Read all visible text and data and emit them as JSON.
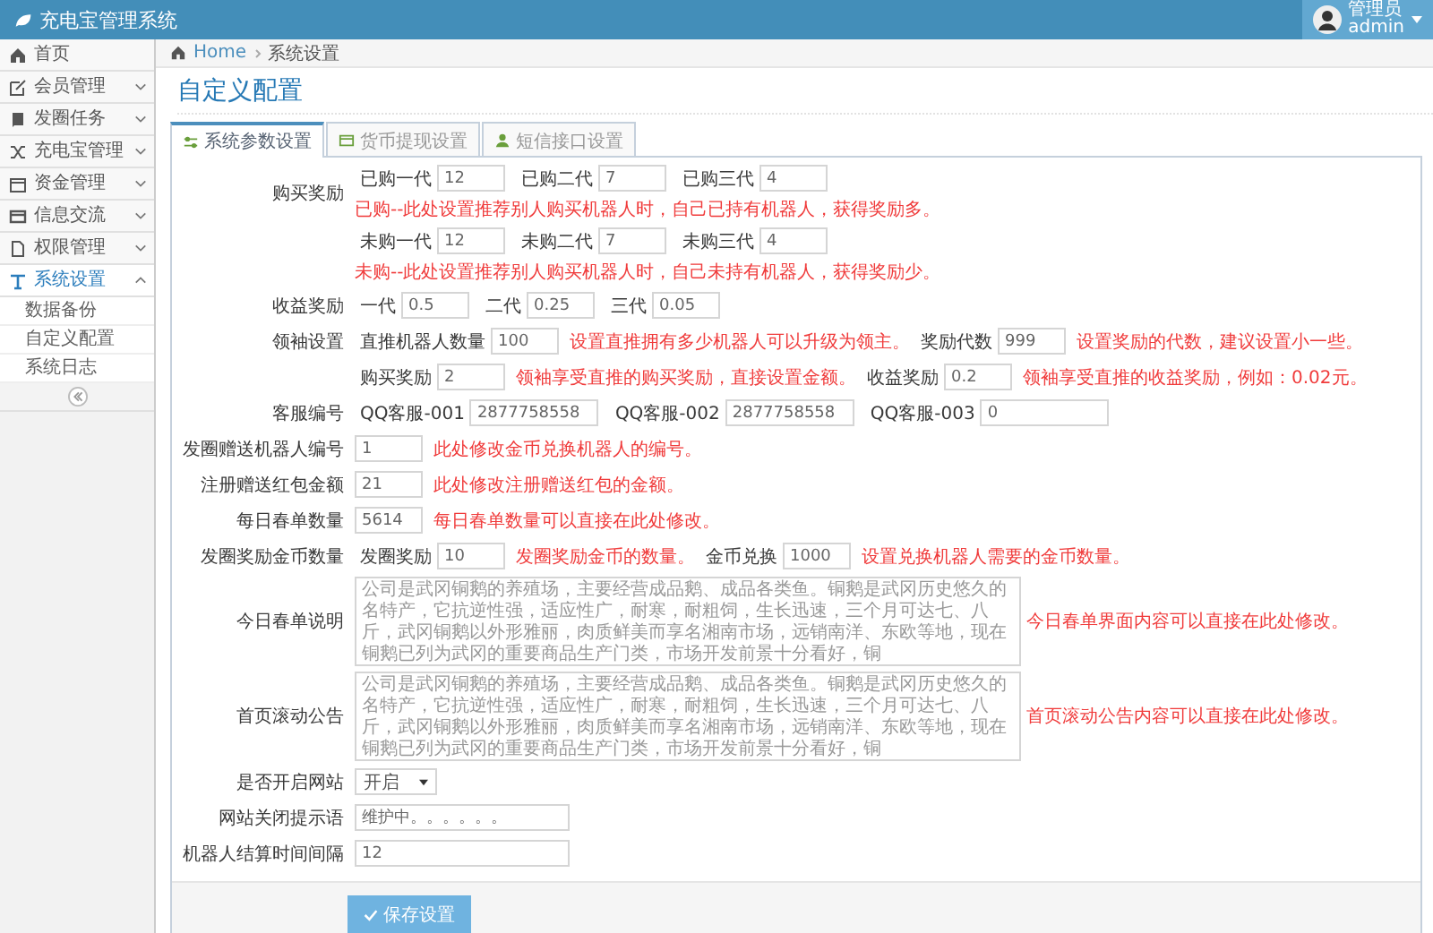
{
  "app": {
    "title": "充电宝管理系统"
  },
  "user": {
    "role": "管理员",
    "name": "admin"
  },
  "sidebar": {
    "items": [
      {
        "label": "首页",
        "kind": "link",
        "selected": false
      },
      {
        "label": "会员管理",
        "kind": "group",
        "selected": false,
        "expanded": false
      },
      {
        "label": "发圈任务",
        "kind": "group",
        "selected": false,
        "expanded": false
      },
      {
        "label": "充电宝管理",
        "kind": "group",
        "selected": false,
        "expanded": false
      },
      {
        "label": "资金管理",
        "kind": "group",
        "selected": false,
        "expanded": false
      },
      {
        "label": "信息交流",
        "kind": "group",
        "selected": false,
        "expanded": false
      },
      {
        "label": "权限管理",
        "kind": "group",
        "selected": false,
        "expanded": false
      },
      {
        "label": "系统设置",
        "kind": "group",
        "selected": true,
        "expanded": true,
        "children": [
          {
            "label": "数据备份"
          },
          {
            "label": "自定义配置"
          },
          {
            "label": "系统日志"
          }
        ]
      }
    ]
  },
  "breadcrumb": [
    "Home",
    "系统设置"
  ],
  "page_title": "自定义配置",
  "tabs": [
    {
      "label": "系统参数设置",
      "selected": true
    },
    {
      "label": "货币提现设置",
      "selected": false
    },
    {
      "label": "短信接口设置",
      "selected": false
    }
  ],
  "form": [
    {
      "label": "购买奖励",
      "kind": "inline",
      "parts": [
        {
          "kind": "field",
          "label": "已购一代",
          "value": "12"
        },
        {
          "kind": "field",
          "label": "已购二代",
          "value": "7"
        },
        {
          "kind": "field",
          "label": "已购三代",
          "value": "4"
        },
        {
          "kind": "note",
          "text": "已购--此处设置推荐别人购买机器人时，自己已持有机器人，获得奖励多。"
        }
      ]
    },
    {
      "kind": "inline",
      "parts": [
        {
          "kind": "field",
          "label": "未购一代",
          "value": "12"
        },
        {
          "kind": "field",
          "label": "未购二代",
          "value": "7"
        },
        {
          "kind": "field",
          "label": "未购三代",
          "value": "4"
        },
        {
          "kind": "note",
          "text": "未购--此处设置推荐别人购买机器人时，自己未持有机器人，获得奖励少。"
        }
      ]
    },
    {
      "label": "收益奖励",
      "kind": "inline",
      "parts": [
        {
          "kind": "field",
          "label": "一代",
          "value": "0.5"
        },
        {
          "kind": "field",
          "label": "二代",
          "value": "0.25"
        },
        {
          "kind": "field",
          "label": "三代",
          "value": "0.05"
        }
      ]
    },
    {
      "label": "领袖设置",
      "kind": "inline",
      "parts": [
        {
          "kind": "field",
          "label": "直推机器人数量",
          "value": "100"
        },
        {
          "kind": "note",
          "text": "设置直推拥有多少机器人可以升级为领主。"
        },
        {
          "kind": "field",
          "label": "奖励代数",
          "value": "999"
        },
        {
          "kind": "note",
          "text": "设置奖励的代数，建议设置小一些。"
        }
      ]
    },
    {
      "kind": "inline",
      "parts": [
        {
          "kind": "field",
          "label": "购买奖励",
          "value": "2"
        },
        {
          "kind": "note",
          "text": "领袖享受直推的购买奖励，直接设置金额。"
        },
        {
          "kind": "field",
          "label": "收益奖励",
          "value": "0.2"
        },
        {
          "kind": "note",
          "text": "领袖享受直推的收益奖励，例如：0.02元。"
        }
      ]
    },
    {
      "label": "客服编号",
      "kind": "inline",
      "parts": [
        {
          "kind": "medium-field",
          "label": "QQ客服-001",
          "value": "2877758558"
        },
        {
          "kind": "medium-field",
          "label": "QQ客服-002",
          "value": "2877758558"
        },
        {
          "kind": "medium-field",
          "label": "QQ客服-003",
          "value": "0"
        }
      ]
    },
    {
      "label": "发圈赠送机器人编号",
      "kind": "inline",
      "parts": [
        {
          "kind": "field",
          "value": "1"
        },
        {
          "kind": "note",
          "text": "此处修改金币兑换机器人的编号。"
        }
      ]
    },
    {
      "label": "注册赠送红包金额",
      "kind": "inline",
      "parts": [
        {
          "kind": "field",
          "value": "21"
        },
        {
          "kind": "note",
          "text": "此处修改注册赠送红包的金额。"
        }
      ]
    },
    {
      "label": "每日春单数量",
      "kind": "inline",
      "parts": [
        {
          "kind": "field",
          "value": "5614"
        },
        {
          "kind": "note",
          "text": "每日春单数量可以直接在此处修改。"
        }
      ]
    },
    {
      "label": "发圈奖励金币数量",
      "kind": "inline",
      "parts": [
        {
          "kind": "field",
          "label": "发圈奖励",
          "value": "10"
        },
        {
          "kind": "note",
          "text": "发圈奖励金币的数量。"
        },
        {
          "kind": "field",
          "label": "金币兑换",
          "value": "1000"
        },
        {
          "kind": "note",
          "text": "设置兑换机器人需要的金币数量。"
        }
      ]
    },
    {
      "label": "今日春单说明",
      "kind": "textarea",
      "value": "公司是武冈铜鹅的养殖场，主要经营成品鹅、成品各类鱼。铜鹅是武冈历史悠久的名特产，它抗逆性强，适应性广，耐寒，耐粗饲，生长迅速，三个月可达七、八斤，武冈铜鹅以外形雅丽，肉质鲜美而享名湘南市场，远销南洋、东欧等地，现在铜鹅已列为武冈的重要商品生产门类，市场开发前景十分看好，铜",
      "note": "今日春单界面内容可以直接在此处修改。"
    },
    {
      "label": "首页滚动公告",
      "kind": "textarea",
      "value": "公司是武冈铜鹅的养殖场，主要经营成品鹅、成品各类鱼。铜鹅是武冈历史悠久的名特产，它抗逆性强，适应性广，耐寒，耐粗饲，生长迅速，三个月可达七、八斤，武冈铜鹅以外形雅丽，肉质鲜美而享名湘南市场，远销南洋、东欧等地，现在铜鹅已列为武冈的重要商品生产门类，市场开发前景十分看好，铜",
      "note": "首页滚动公告内容可以直接在此处修改。"
    },
    {
      "label": "是否开启网站",
      "kind": "select",
      "value": "开启"
    },
    {
      "label": "网站关闭提示语",
      "kind": "inline",
      "parts": [
        {
          "kind": "wide-field",
          "value": "维护中。。。。。。"
        }
      ]
    },
    {
      "label": "机器人结算时间间隔",
      "kind": "inline",
      "parts": [
        {
          "kind": "wide-field",
          "value": "12"
        }
      ]
    }
  ],
  "save_button": "保存设置"
}
